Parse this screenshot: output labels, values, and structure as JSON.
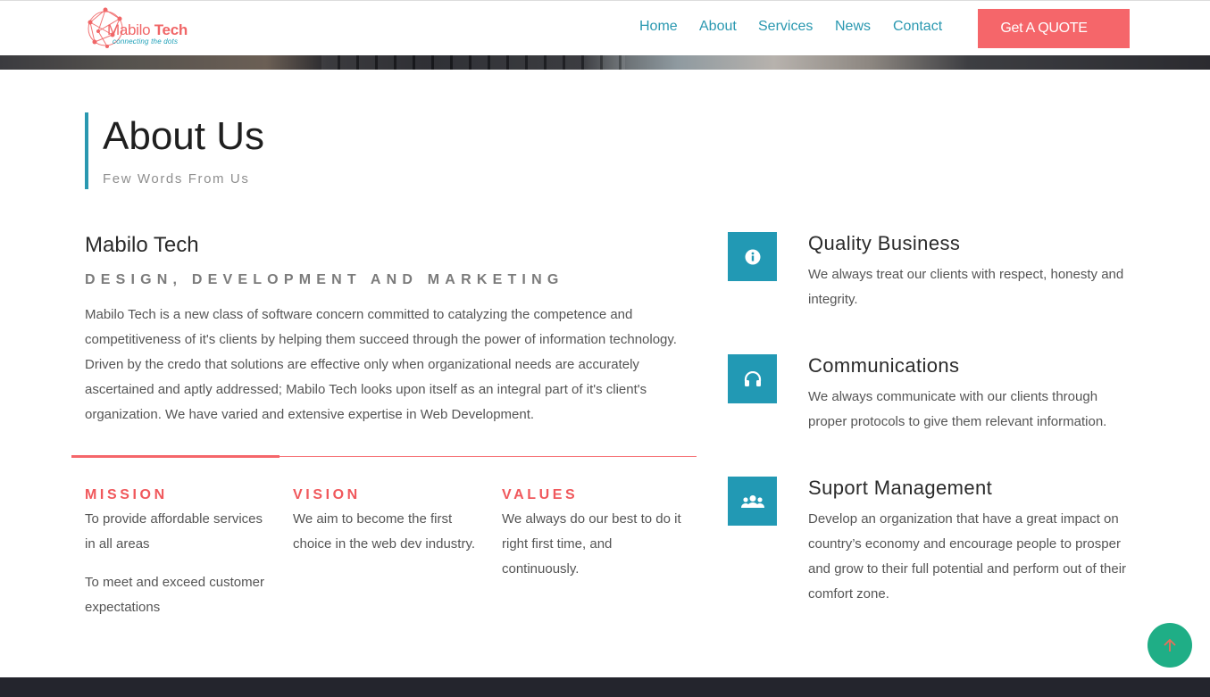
{
  "header": {
    "logo": {
      "brand_light": "Mabilo",
      "brand_bold": "Tech",
      "tagline": "connecting the dots"
    },
    "nav": [
      {
        "label": "Home"
      },
      {
        "label": "About"
      },
      {
        "label": "Services"
      },
      {
        "label": "News"
      },
      {
        "label": "Contact"
      }
    ],
    "quote_button": "Get A QUOTE"
  },
  "about": {
    "title": "About Us",
    "subtitle": "Few Words From Us",
    "company_name": "Mabilo Tech",
    "tagline": "DESIGN, DEVELOPMENT AND MARKETING",
    "description": "Mabilo Tech is a new class of software concern committed to catalyzing the competence and competitiveness of it's clients by helping them succeed through the power of information technology. Driven by the credo that solutions are effective only when organizational needs are accurately ascertained and aptly addressed; Mabilo Tech looks upon itself as an integral part of it's client's organization. We have varied and extensive expertise in Web Development.",
    "columns": [
      {
        "heading": "MISSION",
        "paragraphs": [
          "To provide affordable services in all areas",
          "To meet and exceed customer expectations"
        ]
      },
      {
        "heading": "VISION",
        "paragraphs": [
          "We aim to become the first choice in the web dev industry."
        ]
      },
      {
        "heading": "VALUES",
        "paragraphs": [
          "We always do our best to do it right first time, and continuously."
        ]
      }
    ]
  },
  "features": [
    {
      "icon": "info-icon",
      "title": "Quality Business",
      "text": "We always treat our clients with respect, honesty and integrity."
    },
    {
      "icon": "headphones-icon",
      "title": "Communications",
      "text": "We always communicate with our clients through proper protocols to give them relevant information."
    },
    {
      "icon": "users-icon",
      "title": "Suport Management",
      "text": "Develop an organization that have a great impact on country’s economy and encourage people to prosper and grow to their full potential and perform out of their comfort zone."
    }
  ],
  "colors": {
    "accent_teal": "#2299b4",
    "accent_coral": "#f5666a",
    "scroll_button": "#1fae86",
    "footer": "#24252d"
  },
  "scroll_top_icon": "arrow-up-icon"
}
